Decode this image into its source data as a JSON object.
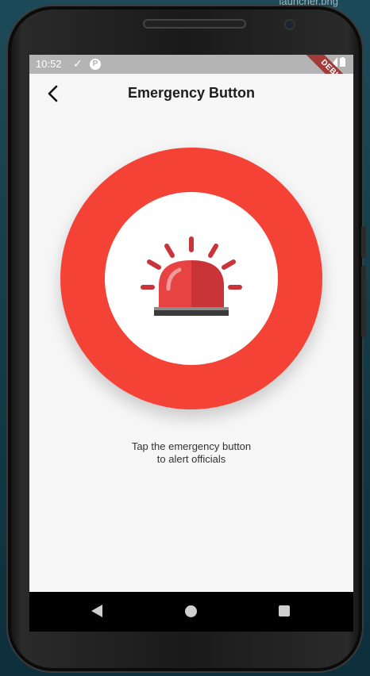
{
  "background": {
    "filename": "launcher.png"
  },
  "statusbar": {
    "time": "10:52",
    "debug_label": "DEBUG"
  },
  "appbar": {
    "title": "Emergency Button"
  },
  "main": {
    "button_color": "#f44336",
    "icon": "siren-icon",
    "caption_line1": "Tap the emergency button",
    "caption_line2": "to alert officials"
  }
}
